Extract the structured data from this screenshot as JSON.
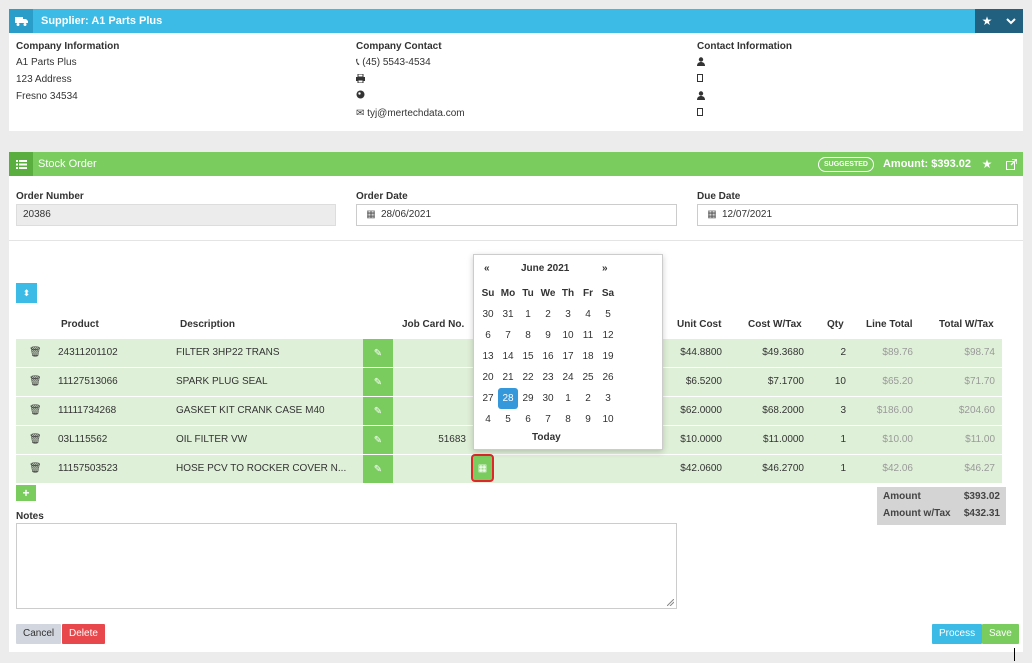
{
  "supplier": {
    "title": "Supplier: A1 Parts Plus",
    "company_info": {
      "label": "Company Information",
      "name": "A1 Parts Plus",
      "address": "123 Address",
      "city": "Fresno 34534"
    },
    "company_contact": {
      "label": "Company Contact",
      "phone": "(45) 5543-4534",
      "email": "tyj@mertechdata.com"
    },
    "contact_info": {
      "label": "Contact Information"
    }
  },
  "stock_order": {
    "title": "Stock Order",
    "badge": "SUGGESTED",
    "amount": "Amount: $393.02",
    "order_number_label": "Order Number",
    "order_number": "20386",
    "order_date_label": "Order Date",
    "order_date": "28/06/2021",
    "due_date_label": "Due Date",
    "due_date": "12/07/2021"
  },
  "table": {
    "headers": {
      "product": "Product",
      "description": "Description",
      "job_card": "Job Card No.",
      "unit_cost": "Unit Cost",
      "cost_wtax": "Cost W/Tax",
      "qty": "Qty",
      "line_total": "Line Total",
      "total_wtax": "Total W/Tax"
    },
    "rows": [
      {
        "product": "24311201102",
        "description": "FILTER 3HP22 TRANS",
        "job_card": "",
        "unit_cost": "$44.8800",
        "cost_wtax": "$49.3680",
        "qty": "2",
        "line_total": "$89.76",
        "total_wtax": "$98.74"
      },
      {
        "product": "11127513066",
        "description": "SPARK PLUG SEAL",
        "job_card": "",
        "unit_cost": "$6.5200",
        "cost_wtax": "$7.1700",
        "qty": "10",
        "line_total": "$65.20",
        "total_wtax": "$71.70"
      },
      {
        "product": "11111734268",
        "description": "GASKET KIT CRANK CASE M40",
        "job_card": "",
        "unit_cost": "$62.0000",
        "cost_wtax": "$68.2000",
        "qty": "3",
        "line_total": "$186.00",
        "total_wtax": "$204.60"
      },
      {
        "product": "03L115562",
        "description": "OIL FILTER VW",
        "job_card": "51683",
        "unit_cost": "$10.0000",
        "cost_wtax": "$11.0000",
        "qty": "1",
        "line_total": "$10.00",
        "total_wtax": "$11.00"
      },
      {
        "product": "11157503523",
        "description": "HOSE PCV TO ROCKER COVER N...",
        "job_card": "",
        "unit_cost": "$42.0600",
        "cost_wtax": "$46.2700",
        "qty": "1",
        "line_total": "$42.06",
        "total_wtax": "$46.27"
      }
    ]
  },
  "calendar": {
    "prev": "«",
    "next": "»",
    "month": "June 2021",
    "days": [
      "Su",
      "Mo",
      "Tu",
      "We",
      "Th",
      "Fr",
      "Sa"
    ],
    "weeks": [
      [
        "30",
        "31",
        "1",
        "2",
        "3",
        "4",
        "5"
      ],
      [
        "6",
        "7",
        "8",
        "9",
        "10",
        "11",
        "12"
      ],
      [
        "13",
        "14",
        "15",
        "16",
        "17",
        "18",
        "19"
      ],
      [
        "20",
        "21",
        "22",
        "23",
        "24",
        "25",
        "26"
      ],
      [
        "27",
        "28",
        "29",
        "30",
        "1",
        "2",
        "3"
      ],
      [
        "4",
        "5",
        "6",
        "7",
        "8",
        "9",
        "10"
      ]
    ],
    "selected": "28",
    "today": "Today"
  },
  "totals": {
    "amount_label": "Amount",
    "amount": "$393.02",
    "amount_tax_label": "Amount w/Tax",
    "amount_tax": "$432.31"
  },
  "notes_label": "Notes",
  "buttons": {
    "cancel": "Cancel",
    "delete": "Delete",
    "process": "Process",
    "save": "Save"
  },
  "colors": {
    "blue": "#3bbbe6",
    "green": "#7acc5f",
    "row_green": "#dff0d8",
    "red": "#e8474b",
    "selected_day": "#3598db"
  }
}
